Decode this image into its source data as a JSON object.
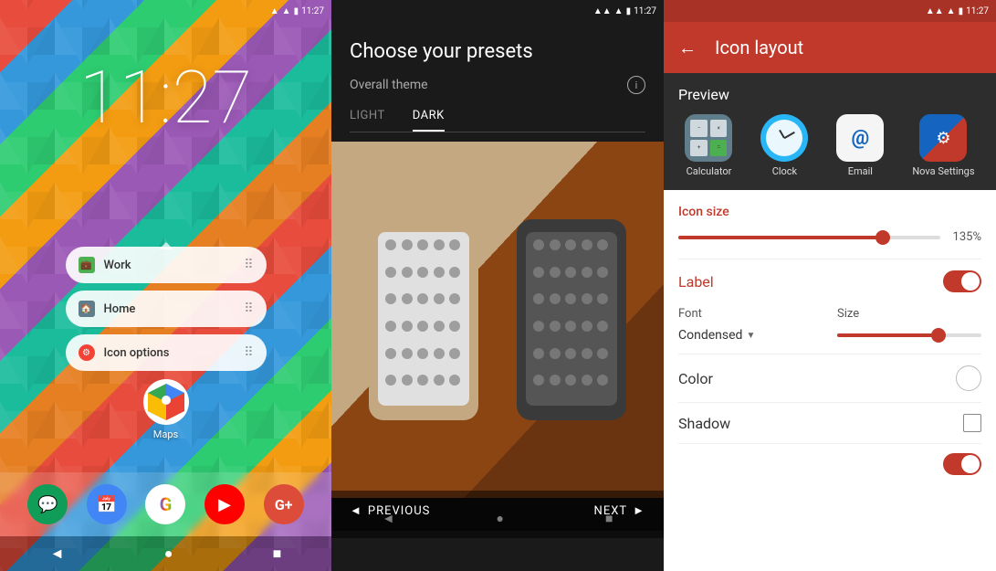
{
  "panel1": {
    "status": {
      "time": "11:27",
      "signal": "▲▼",
      "battery": "■"
    },
    "clock": "11:27",
    "shortcuts": [
      {
        "icon": "work",
        "label": "Work"
      },
      {
        "icon": "home",
        "label": "Home"
      },
      {
        "icon": "options",
        "label": "Icon options"
      }
    ],
    "maps_label": "Maps",
    "dock_apps": [
      "Hangouts",
      "Calendar",
      "Google",
      "YouTube",
      "G+"
    ],
    "nav": [
      "◄",
      "●",
      "■"
    ]
  },
  "panel2": {
    "status": {
      "time": "11:27"
    },
    "title": "Choose your presets",
    "overall_theme_label": "Overall theme",
    "tabs": [
      "LIGHT",
      "DARK"
    ],
    "active_tab": "DARK",
    "nav": {
      "prev": "PREVIOUS",
      "next": "NEXT"
    }
  },
  "panel3": {
    "status": {
      "time": "11:27"
    },
    "title": "Icon layout",
    "preview_label": "Preview",
    "icons": [
      {
        "name": "Calculator",
        "type": "calculator"
      },
      {
        "name": "Clock",
        "type": "clock"
      },
      {
        "name": "Email",
        "type": "email"
      },
      {
        "name": "Nova Settings",
        "type": "nova"
      }
    ],
    "icon_size_label": "Icon size",
    "icon_size_value": "135%",
    "icon_size_percent": 78,
    "label_label": "Label",
    "font_label": "Font",
    "size_label": "Size",
    "font_value": "Condensed",
    "color_label": "Color",
    "shadow_label": "Shadow"
  }
}
